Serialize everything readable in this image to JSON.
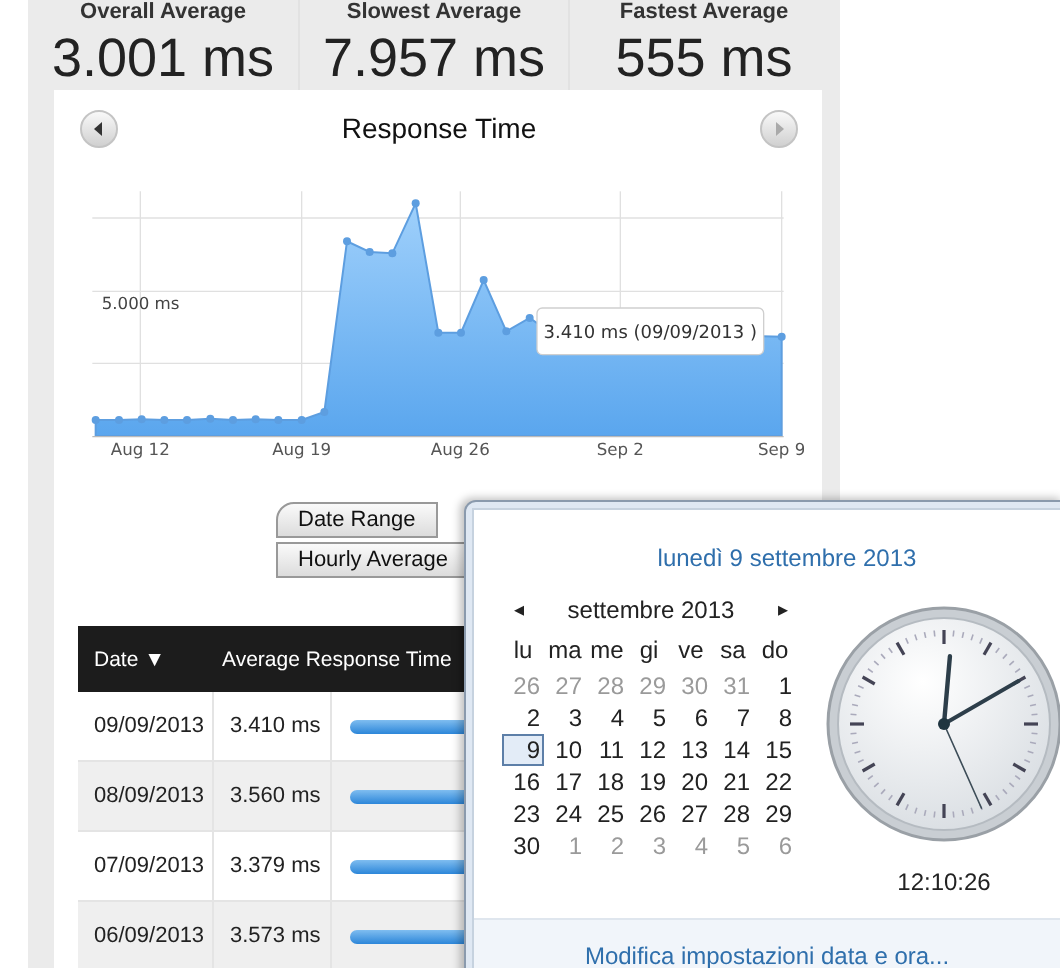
{
  "stats": [
    {
      "label": "Overall Average",
      "value": "3.001 ms"
    },
    {
      "label": "Slowest Average",
      "value": "7.957 ms"
    },
    {
      "label": "Fastest Average",
      "value": "555 ms"
    }
  ],
  "chart": {
    "title": "Response Time",
    "y_tick": "5.000 ms",
    "x_labels": [
      "Aug 12",
      "Aug 19",
      "Aug 26",
      "Sep 2",
      "Sep 9"
    ],
    "tooltip": "3.410 ms (09/09/2013 )"
  },
  "buttons": [
    {
      "label": "Date Range"
    },
    {
      "label": "Hourly Average"
    }
  ],
  "table": {
    "columns": [
      {
        "label": "Date ▼"
      },
      {
        "label": "Average Response Time"
      }
    ],
    "rows": [
      {
        "date": "09/09/2013",
        "value": "3.410 ms"
      },
      {
        "date": "08/09/2013",
        "value": "3.560 ms"
      },
      {
        "date": "07/09/2013",
        "value": "3.379 ms"
      },
      {
        "date": "06/09/2013",
        "value": "3.573 ms"
      }
    ]
  },
  "calendar_popup": {
    "heading": "lunedì 9 settembre 2013",
    "month": "settembre 2013",
    "prev": "◂",
    "next": "▸",
    "weekdays": [
      "lu",
      "ma",
      "me",
      "gi",
      "ve",
      "sa",
      "do"
    ],
    "days": [
      {
        "label": "26",
        "muted": true,
        "selected": false
      },
      {
        "label": "27",
        "muted": true,
        "selected": false
      },
      {
        "label": "28",
        "muted": true,
        "selected": false
      },
      {
        "label": "29",
        "muted": true,
        "selected": false
      },
      {
        "label": "30",
        "muted": true,
        "selected": false
      },
      {
        "label": "31",
        "muted": true,
        "selected": false
      },
      {
        "label": "1",
        "muted": false,
        "selected": false
      },
      {
        "label": "2",
        "muted": false,
        "selected": false
      },
      {
        "label": "3",
        "muted": false,
        "selected": false
      },
      {
        "label": "4",
        "muted": false,
        "selected": false
      },
      {
        "label": "5",
        "muted": false,
        "selected": false
      },
      {
        "label": "6",
        "muted": false,
        "selected": false
      },
      {
        "label": "7",
        "muted": false,
        "selected": false
      },
      {
        "label": "8",
        "muted": false,
        "selected": false
      },
      {
        "label": "9",
        "muted": false,
        "selected": true
      },
      {
        "label": "10",
        "muted": false,
        "selected": false
      },
      {
        "label": "11",
        "muted": false,
        "selected": false
      },
      {
        "label": "12",
        "muted": false,
        "selected": false
      },
      {
        "label": "13",
        "muted": false,
        "selected": false
      },
      {
        "label": "14",
        "muted": false,
        "selected": false
      },
      {
        "label": "15",
        "muted": false,
        "selected": false
      },
      {
        "label": "16",
        "muted": false,
        "selected": false
      },
      {
        "label": "17",
        "muted": false,
        "selected": false
      },
      {
        "label": "18",
        "muted": false,
        "selected": false
      },
      {
        "label": "19",
        "muted": false,
        "selected": false
      },
      {
        "label": "20",
        "muted": false,
        "selected": false
      },
      {
        "label": "21",
        "muted": false,
        "selected": false
      },
      {
        "label": "22",
        "muted": false,
        "selected": false
      },
      {
        "label": "23",
        "muted": false,
        "selected": false
      },
      {
        "label": "24",
        "muted": false,
        "selected": false
      },
      {
        "label": "25",
        "muted": false,
        "selected": false
      },
      {
        "label": "26",
        "muted": false,
        "selected": false
      },
      {
        "label": "27",
        "muted": false,
        "selected": false
      },
      {
        "label": "28",
        "muted": false,
        "selected": false
      },
      {
        "label": "29",
        "muted": false,
        "selected": false
      },
      {
        "label": "30",
        "muted": false,
        "selected": false
      },
      {
        "label": "1",
        "muted": true,
        "selected": false
      },
      {
        "label": "2",
        "muted": true,
        "selected": false
      },
      {
        "label": "3",
        "muted": true,
        "selected": false
      },
      {
        "label": "4",
        "muted": true,
        "selected": false
      },
      {
        "label": "5",
        "muted": true,
        "selected": false
      },
      {
        "label": "6",
        "muted": true,
        "selected": false
      }
    ],
    "time": "12:10:26",
    "settings_link": "Modifica impostazioni data e ora..."
  }
}
